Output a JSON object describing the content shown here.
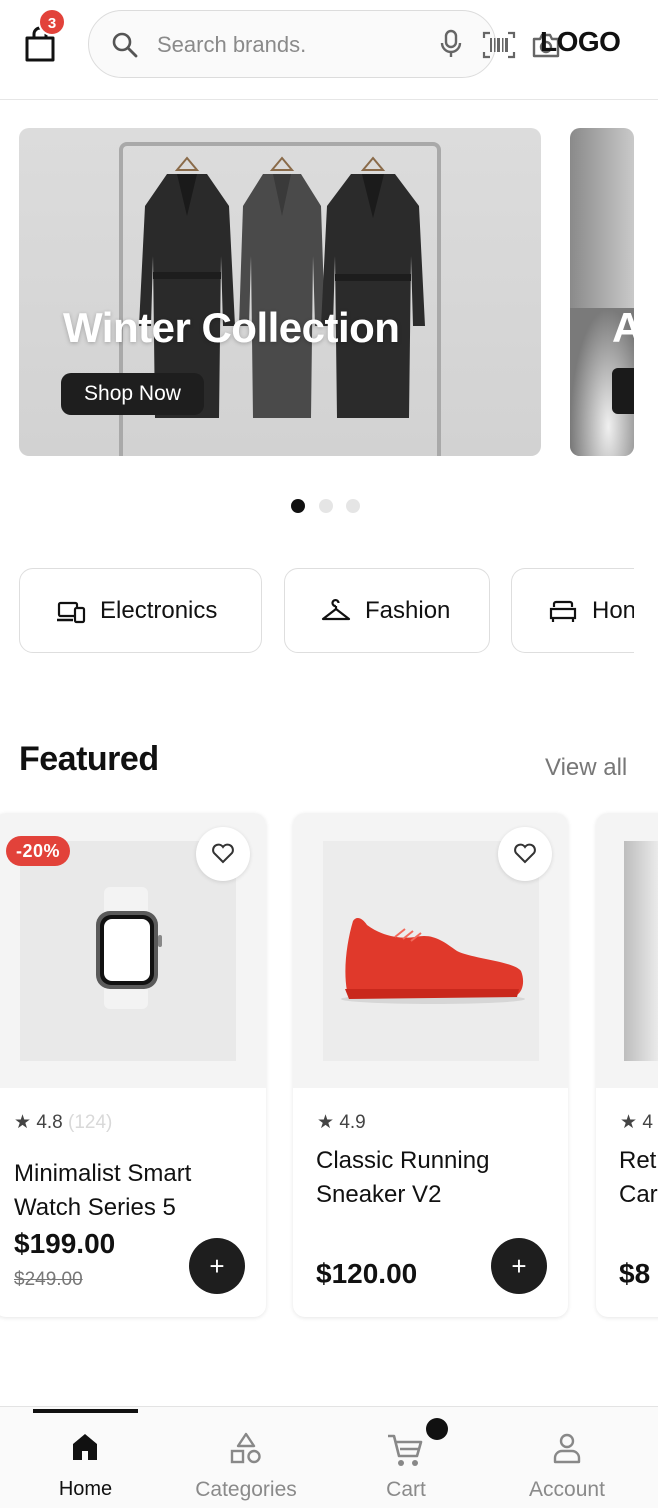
{
  "header": {
    "cart_count": "3",
    "search_placeholder": "Search brands.",
    "logo": "LOGO"
  },
  "banners": [
    {
      "title": "Winter Collection",
      "button": "Shop Now"
    },
    {
      "title": "A"
    }
  ],
  "carousel": {
    "pages": 3,
    "active": 1
  },
  "categories": [
    {
      "label": "Electronics",
      "icon": "devices-icon"
    },
    {
      "label": "Fashion",
      "icon": "hanger-icon"
    },
    {
      "label": "Hon",
      "icon": "sofa-icon"
    }
  ],
  "featured": {
    "title": "Featured",
    "view_all": "View all",
    "products": [
      {
        "badge": "-20%",
        "rating": "4.8",
        "reviews": "(124)",
        "name_line1": "Minimalist Smart",
        "name_line2": "Watch Series 5",
        "price": "$199.00",
        "old_price": "$249.00",
        "add": "+"
      },
      {
        "rating": "4.9",
        "name_line1": "Classic Running",
        "name_line2": "Sneaker V2",
        "price": "$120.00",
        "add": "+"
      },
      {
        "rating": "4",
        "name_line1": "Retr",
        "name_line2": "Car",
        "price": "$8"
      }
    ]
  },
  "bottom_nav": {
    "home": "Home",
    "categories": "Categories",
    "cart": "Cart",
    "account": "Account"
  },
  "colors": {
    "accent_red": "#e2423a",
    "dark": "#1e1e1e",
    "sneaker_red": "#e0392b"
  }
}
